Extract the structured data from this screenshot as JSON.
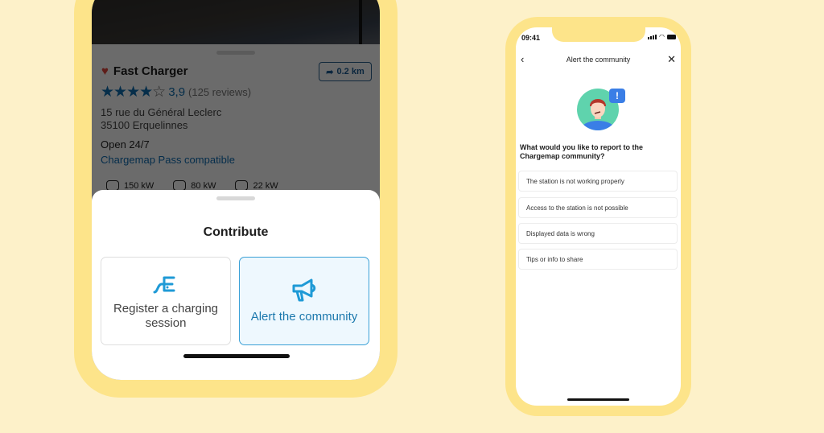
{
  "left_phone": {
    "station": {
      "name": "Fast Charger",
      "favorite_icon": "heart-icon",
      "distance_label": "0.2 km",
      "distance_icon": "turn-right-arrow-icon",
      "stars_filled": 4,
      "stars_total": 5,
      "stars_filled_text": "★★★★",
      "stars_empty_text": "☆",
      "rating": "3,9",
      "reviews": "(125 reviews)",
      "address_line1": "15 rue du Général Leclerc",
      "address_line2": "35100 Erquelinnes",
      "hours": "Open 24/7",
      "pass_compat": "Chargemap Pass compatible",
      "powers": [
        "150 kW",
        "80 kW",
        "22 kW"
      ]
    },
    "sheet": {
      "title": "Contribute",
      "cards": [
        {
          "label": "Register a charging session",
          "icon": "charging-plug-icon"
        },
        {
          "label": "Alert the community",
          "icon": "megaphone-icon"
        }
      ]
    }
  },
  "right_phone": {
    "status_time": "09:41",
    "nav": {
      "back_icon": "‹",
      "title": "Alert the community",
      "close_icon": "✕"
    },
    "bubble_glyph": "!",
    "question": "What would you like to report to the Chargemap community?",
    "options": [
      "The station is not working properly",
      "Access to the station is not possible",
      "Displayed data is wrong",
      "Tips or info to share"
    ]
  },
  "colors": {
    "background": "#fdf1c9",
    "frame": "#fde48a",
    "accent_blue": "#1b78ad",
    "star_blue": "#0f6fb0"
  }
}
